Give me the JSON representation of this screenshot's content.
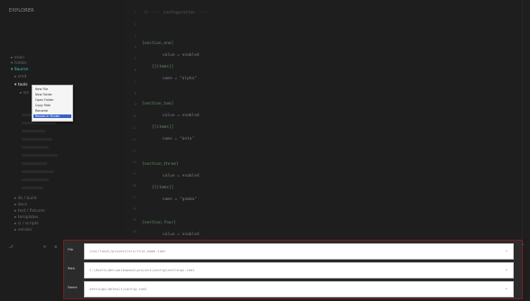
{
  "explorer": {
    "title": "EXPLORER",
    "items": [
      {
        "label": "▸ main",
        "state": "normal"
      },
      {
        "label": "▾ Folder",
        "state": "normal"
      },
      {
        "label": "▾ Source",
        "state": "highlight"
      },
      {
        "label": "▸ cmd",
        "state": "normal"
      },
      {
        "label": "▾ tools",
        "state": "selected"
      },
      {
        "label": "▸ src",
        "state": "normal"
      }
    ],
    "bottom_items": [
      {
        "label": "▸ lib / build"
      },
      {
        "label": "▸ docs"
      },
      {
        "label": "▸ test / fixtures"
      },
      {
        "label": "▸ templates"
      },
      {
        "label": "▸ ci / scripts"
      },
      {
        "label": "▸ vendor"
      }
    ]
  },
  "context_menu": {
    "items": [
      {
        "label": "New File",
        "active": false
      },
      {
        "label": "New Folder",
        "active": false
      },
      {
        "label": "Open Folder",
        "active": false
      },
      {
        "label": "Copy Path",
        "active": false
      },
      {
        "label": "Rename",
        "active": false
      },
      {
        "label": "Reveal in Finder",
        "active": true
      }
    ]
  },
  "editor": {
    "top_line": "// ---- configuration ----",
    "blocks": [
      {
        "head": "[section_one]",
        "key": "value = enabled",
        "sub": "[[items]]",
        "sub_val": "name = \"alpha\""
      },
      {
        "head": "[section_two]",
        "key": "value = enabled",
        "sub": "[[items]]",
        "sub_val": "name = \"beta\""
      },
      {
        "head": "[section_three]",
        "key": "value = enabled",
        "sub": "[[items]]",
        "sub_val": "name = \"gamma\""
      },
      {
        "head": "[section_four]",
        "key": "value = enabled",
        "sub": "",
        "sub_val": ""
      }
    ]
  },
  "panel": {
    "rows": [
      {
        "label": "File",
        "value": "/usr/local/project/src/file_name.toml"
      },
      {
        "label": "Path",
        "value": "C:\\Users\\dev\\workspace\\project\\config\\settings.toml"
      },
      {
        "label": "Name",
        "value": "settings/default/config.toml"
      }
    ]
  },
  "icons": {
    "chevron": "chevron-down-icon",
    "status": [
      "branch-icon",
      "sync-icon",
      "error-icon"
    ]
  }
}
